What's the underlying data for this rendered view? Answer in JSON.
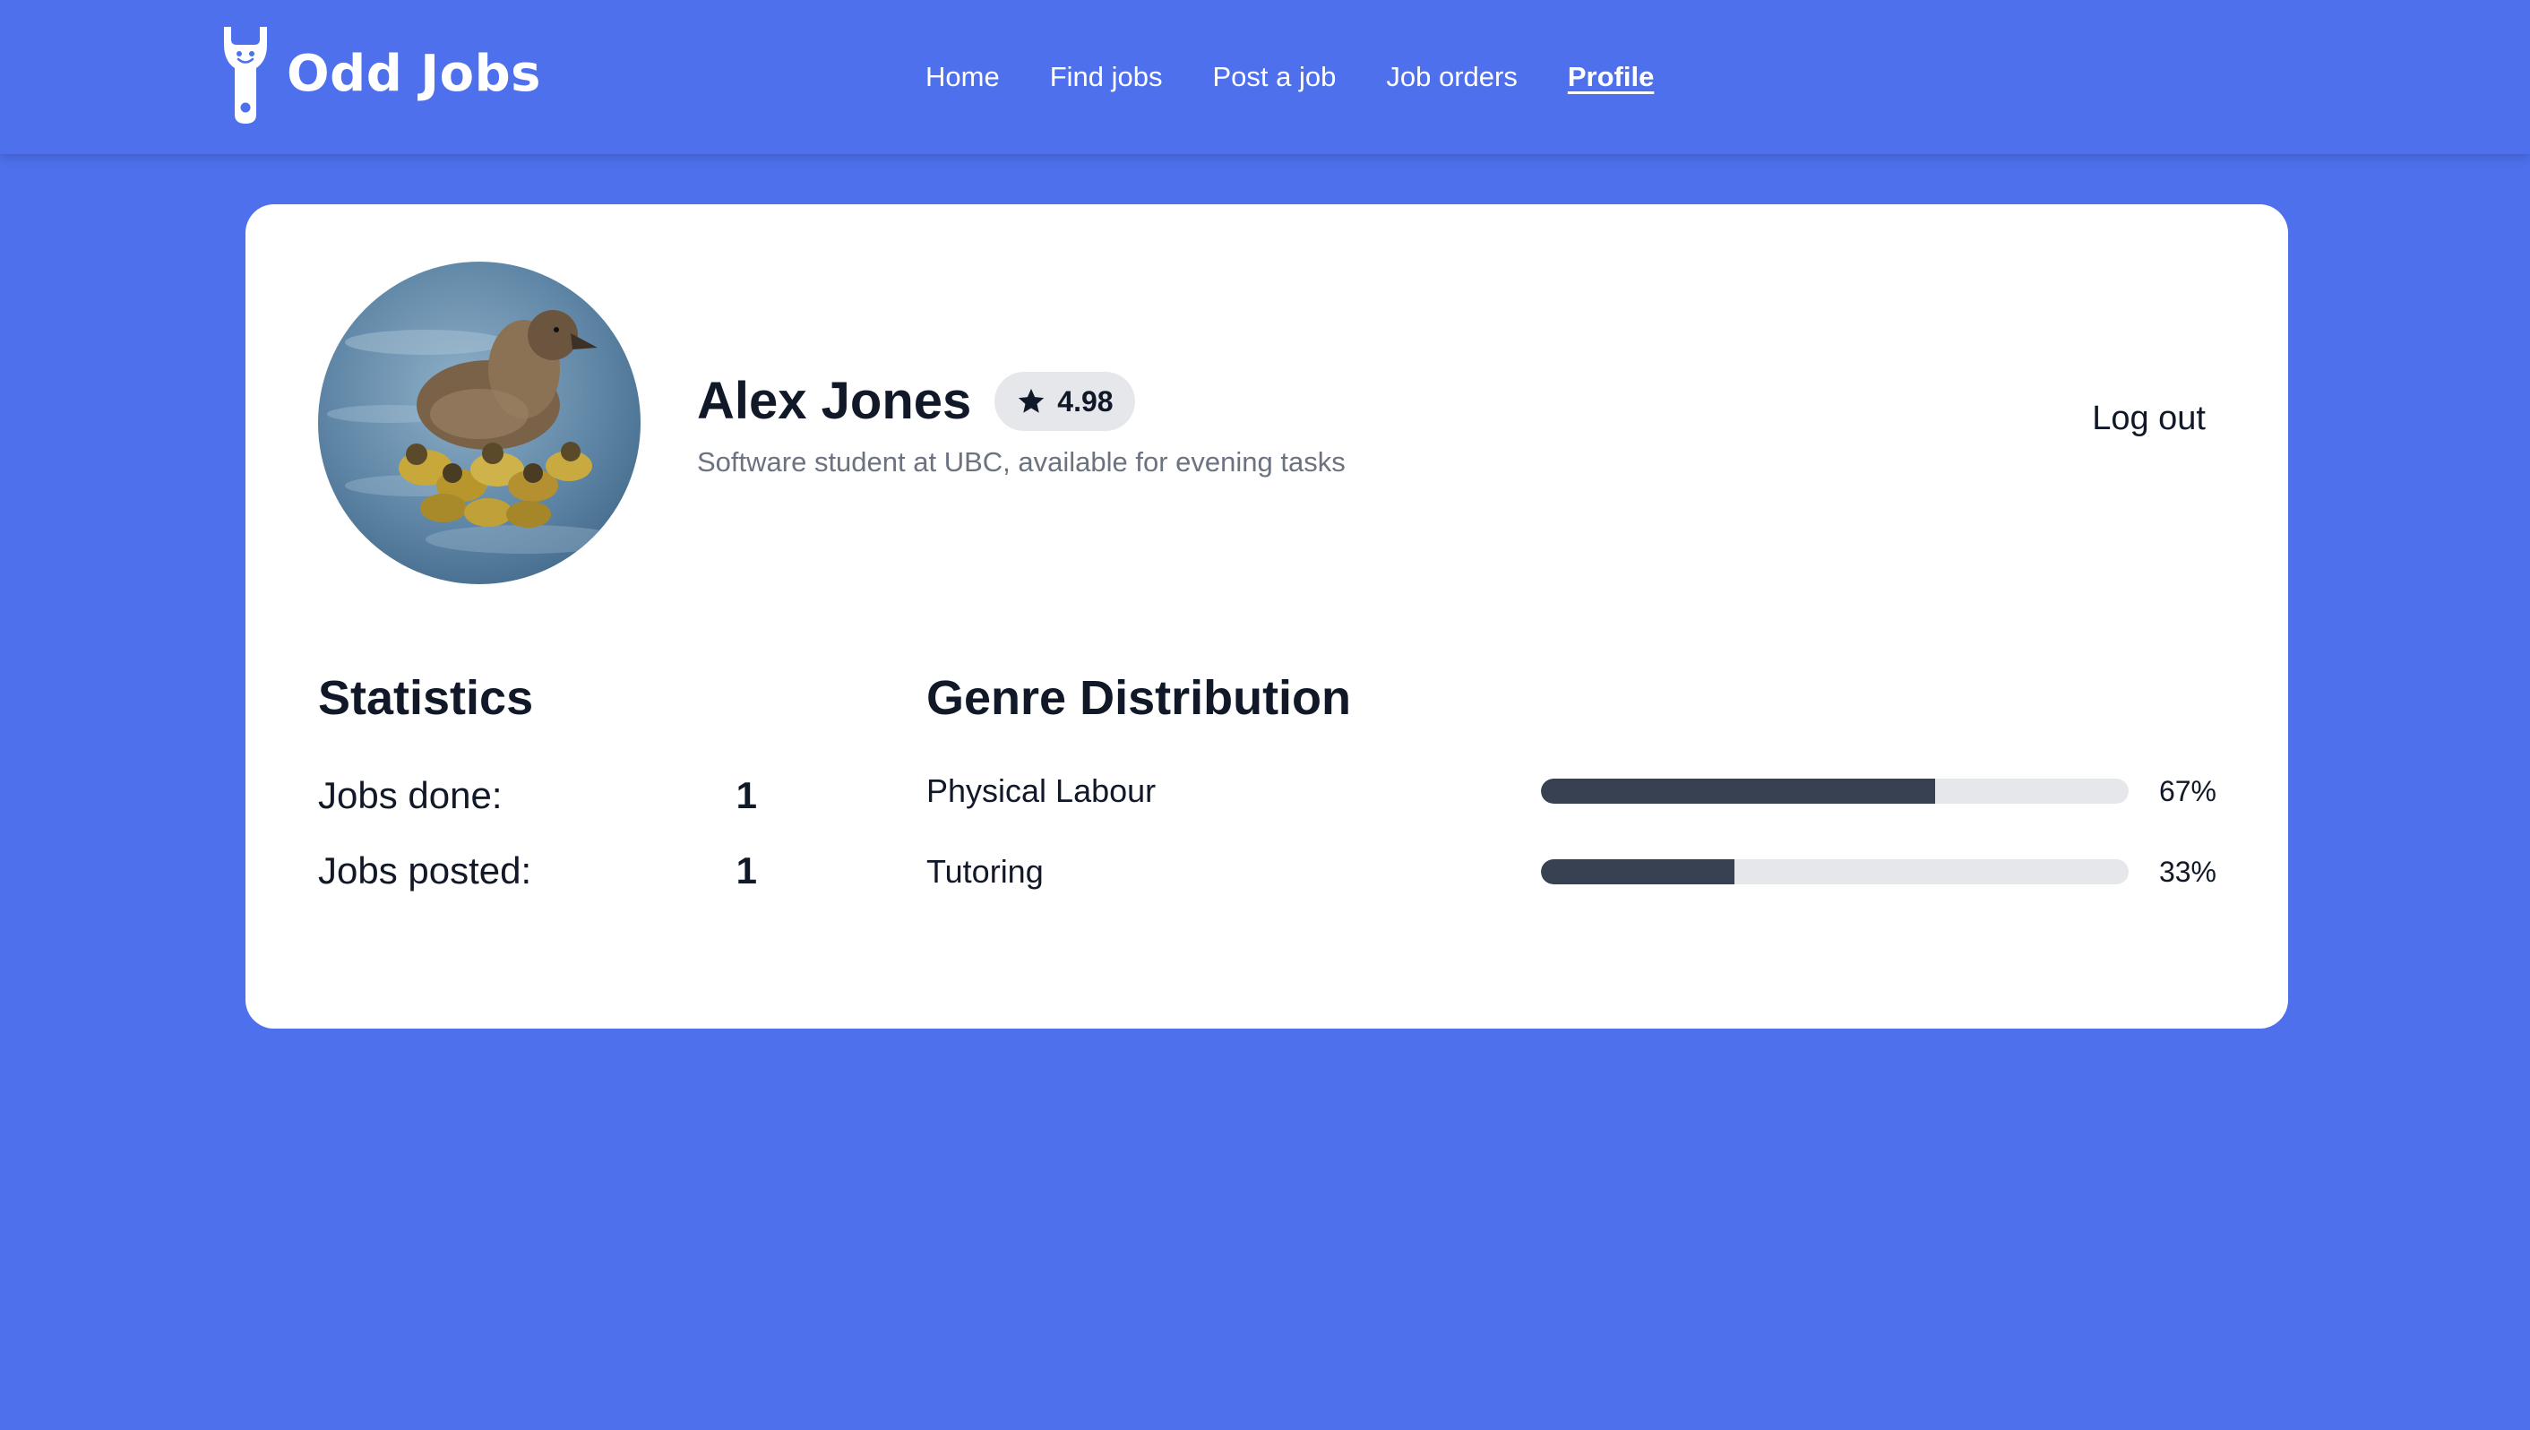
{
  "brand": {
    "name": "Odd Jobs",
    "colors": {
      "background": "#4e70ec",
      "card": "#ffffff",
      "bar_fill": "#374151",
      "bar_track": "#e5e7eb"
    }
  },
  "nav": {
    "items": [
      {
        "label": "Home",
        "active": false
      },
      {
        "label": "Find jobs",
        "active": false
      },
      {
        "label": "Post a job",
        "active": false
      },
      {
        "label": "Job orders",
        "active": false
      },
      {
        "label": "Profile",
        "active": true
      }
    ]
  },
  "profile": {
    "name": "Alex Jones",
    "rating": "4.98",
    "rating_icon": "star-icon",
    "bio": "Software student at UBC, available for evening tasks",
    "logout_label": "Log out",
    "avatar_icon": "duck-photo"
  },
  "statistics": {
    "title": "Statistics",
    "rows": [
      {
        "label": "Jobs done:",
        "value": "1"
      },
      {
        "label": "Jobs posted:",
        "value": "1"
      }
    ]
  },
  "genres": {
    "title": "Genre Distribution",
    "rows": [
      {
        "label": "Physical Labour",
        "percent": 67,
        "percent_label": "67%"
      },
      {
        "label": "Tutoring",
        "percent": 33,
        "percent_label": "33%"
      }
    ]
  }
}
